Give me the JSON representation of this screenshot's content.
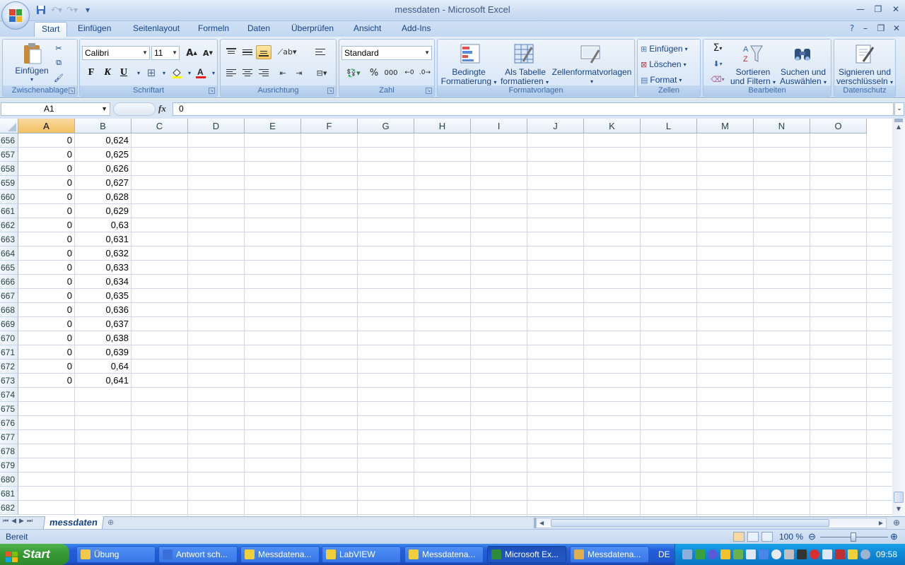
{
  "window": {
    "title": "messdaten - Microsoft Excel"
  },
  "quick_access": {
    "icons": [
      "save-icon",
      "undo-icon",
      "redo-icon",
      "customize-icon"
    ]
  },
  "tabs": [
    {
      "label": "Start",
      "active": true
    },
    {
      "label": "Einfügen"
    },
    {
      "label": "Seitenlayout"
    },
    {
      "label": "Formeln"
    },
    {
      "label": "Daten"
    },
    {
      "label": "Überprüfen"
    },
    {
      "label": "Ansicht"
    },
    {
      "label": "Add-Ins"
    }
  ],
  "ribbon": {
    "clipboard": {
      "label": "Zwischenablage",
      "paste": "Einfügen"
    },
    "font": {
      "label": "Schriftart",
      "family": "Calibri",
      "size": "11",
      "bold": "F",
      "italic": "K",
      "underline": "U"
    },
    "alignment": {
      "label": "Ausrichtung"
    },
    "number": {
      "label": "Zahl",
      "format": "Standard",
      "percent": "%",
      "thousands": "000"
    },
    "styles": {
      "label": "Formatvorlagen",
      "cond_line1": "Bedingte",
      "cond_line2": "Formatierung",
      "table_line1": "Als Tabelle",
      "table_line2": "formatieren",
      "cellstyles": "Zellenformatvorlagen"
    },
    "cells": {
      "label": "Zellen",
      "insert": "Einfügen",
      "delete": "Löschen",
      "format": "Format"
    },
    "editing": {
      "label": "Bearbeiten",
      "sort_line1": "Sortieren",
      "sort_line2": "und Filtern",
      "find_line1": "Suchen und",
      "find_line2": "Auswählen"
    },
    "protection": {
      "label": "Datenschutz",
      "sign_line1": "Signieren und",
      "sign_line2": "verschlüsseln"
    }
  },
  "formula_bar": {
    "name_box": "A1",
    "fx": "fx",
    "value": "0"
  },
  "columns": [
    "A",
    "B",
    "C",
    "D",
    "E",
    "F",
    "G",
    "H",
    "I",
    "J",
    "K",
    "L",
    "M",
    "N",
    "O"
  ],
  "rows": [
    {
      "n": "656",
      "a": "0",
      "b": "0,624"
    },
    {
      "n": "657",
      "a": "0",
      "b": "0,625"
    },
    {
      "n": "658",
      "a": "0",
      "b": "0,626"
    },
    {
      "n": "659",
      "a": "0",
      "b": "0,627"
    },
    {
      "n": "660",
      "a": "0",
      "b": "0,628"
    },
    {
      "n": "661",
      "a": "0",
      "b": "0,629"
    },
    {
      "n": "662",
      "a": "0",
      "b": "0,63"
    },
    {
      "n": "663",
      "a": "0",
      "b": "0,631"
    },
    {
      "n": "664",
      "a": "0",
      "b": "0,632"
    },
    {
      "n": "665",
      "a": "0",
      "b": "0,633"
    },
    {
      "n": "666",
      "a": "0",
      "b": "0,634"
    },
    {
      "n": "667",
      "a": "0",
      "b": "0,635"
    },
    {
      "n": "668",
      "a": "0",
      "b": "0,636"
    },
    {
      "n": "669",
      "a": "0",
      "b": "0,637"
    },
    {
      "n": "670",
      "a": "0",
      "b": "0,638"
    },
    {
      "n": "671",
      "a": "0",
      "b": "0,639"
    },
    {
      "n": "672",
      "a": "0",
      "b": "0,64"
    },
    {
      "n": "673",
      "a": "0",
      "b": "0,641"
    },
    {
      "n": "674",
      "a": "",
      "b": ""
    },
    {
      "n": "675",
      "a": "",
      "b": ""
    },
    {
      "n": "676",
      "a": "",
      "b": ""
    },
    {
      "n": "677",
      "a": "",
      "b": ""
    },
    {
      "n": "678",
      "a": "",
      "b": ""
    },
    {
      "n": "679",
      "a": "",
      "b": ""
    },
    {
      "n": "680",
      "a": "",
      "b": ""
    },
    {
      "n": "681",
      "a": "",
      "b": ""
    },
    {
      "n": "682",
      "a": "",
      "b": ""
    }
  ],
  "sheet_tab": "messdaten",
  "status": {
    "ready": "Bereit",
    "zoom": "100 %"
  },
  "taskbar": {
    "start": "Start",
    "items": [
      {
        "label": "Übung",
        "icon": "folder-icon",
        "color": "#f3c94a"
      },
      {
        "label": "Antwort sch...",
        "icon": "browser-icon",
        "color": "#3a6fd8"
      },
      {
        "label": "Messdatena...",
        "icon": "labview-icon",
        "color": "#f0d03a"
      },
      {
        "label": "LabVIEW",
        "icon": "labview-icon",
        "color": "#f0d03a"
      },
      {
        "label": "Messdatena...",
        "icon": "labview-icon",
        "color": "#f0d03a"
      },
      {
        "label": "Microsoft Ex...",
        "icon": "excel-icon",
        "color": "#2e8b3a",
        "active": true
      },
      {
        "label": "Messdatena...",
        "icon": "labview-icon",
        "color": "#e0b050"
      }
    ],
    "lang": "DE",
    "clock": "09:58"
  }
}
